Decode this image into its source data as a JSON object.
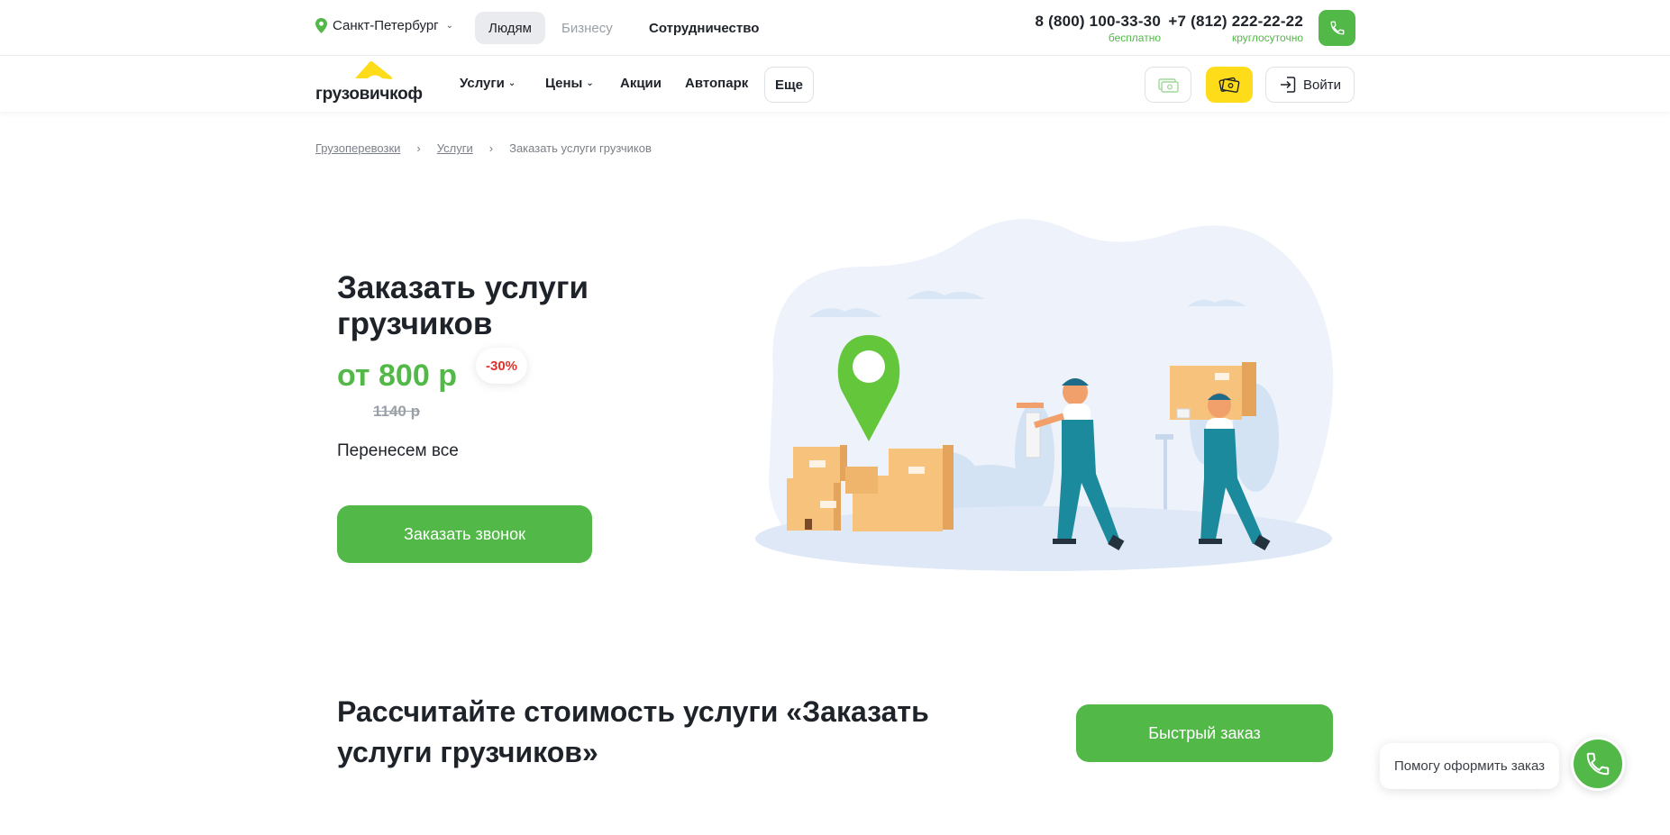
{
  "topbar": {
    "city": "Санкт-Петербург",
    "segments": {
      "people": "Людям",
      "business": "Бизнесу",
      "cooperation": "Сотрудничество"
    },
    "phones": [
      {
        "number": "8 (800) 100-33-30",
        "note": "бесплатно"
      },
      {
        "number": "+7 (812) 222-22-22",
        "note": "круглосуточно"
      }
    ],
    "icons": {
      "city": "location-pin-icon",
      "call": "phone-icon"
    }
  },
  "nav": {
    "logo_text": "грузовичкоф",
    "items": {
      "services": "Услуги",
      "prices": "Цены",
      "promos": "Акции",
      "fleet": "Автопарк"
    },
    "more": "Еще",
    "login": "Войти",
    "icons": [
      "money-icon",
      "cashback-icon",
      "login-icon"
    ]
  },
  "breadcrumb": {
    "items": [
      "Грузоперевозки",
      "Услуги"
    ],
    "current": "Заказать услуги грузчиков"
  },
  "hero": {
    "title": "Заказать услуги грузчиков",
    "price": "от 800 р",
    "discount": "-30%",
    "old_price": "1140 р",
    "subtitle": "Перенесем все",
    "cta": "Заказать звонок"
  },
  "calc": {
    "title": "Рассчитайте стоимость услуги «Заказать услуги грузчиков»",
    "quick_order": "Быстрый заказ"
  },
  "help": {
    "text": "Помогу оформить заказ"
  },
  "colors": {
    "accent": "#52b848",
    "brand_yellow": "#ffdc1a",
    "discount": "#e0312b"
  }
}
